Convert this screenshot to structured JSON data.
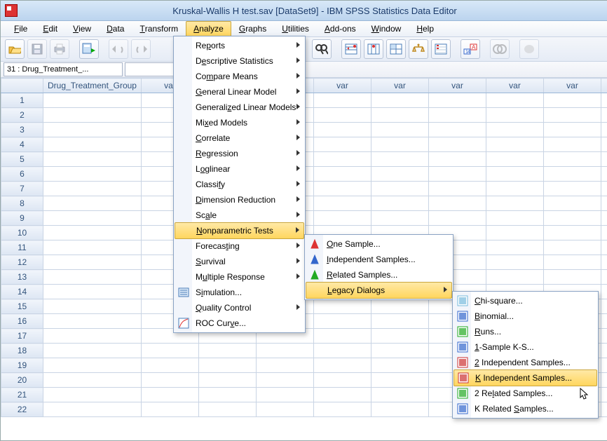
{
  "title": "Kruskal-Wallis H test.sav [DataSet9] - IBM SPSS Statistics Data Editor",
  "menubar": [
    "File",
    "Edit",
    "View",
    "Data",
    "Transform",
    "Analyze",
    "Graphs",
    "Utilities",
    "Add-ons",
    "Window",
    "Help"
  ],
  "menubar_active_index": 5,
  "cellref": "31 : Drug_Treatment_...",
  "columns": {
    "first": "Drug_Treatment_Group",
    "rest_label": "var"
  },
  "rows": 22,
  "analyze_menu": [
    {
      "label": "Reports",
      "sub": true
    },
    {
      "label": "Descriptive Statistics",
      "sub": true
    },
    {
      "label": "Compare Means",
      "sub": true
    },
    {
      "label": "General Linear Model",
      "sub": true
    },
    {
      "label": "Generalized Linear Models",
      "sub": true
    },
    {
      "label": "Mixed Models",
      "sub": true
    },
    {
      "label": "Correlate",
      "sub": true
    },
    {
      "label": "Regression",
      "sub": true
    },
    {
      "label": "Loglinear",
      "sub": true
    },
    {
      "label": "Classify",
      "sub": true
    },
    {
      "label": "Dimension Reduction",
      "sub": true
    },
    {
      "label": "Scale",
      "sub": true
    },
    {
      "label": "Nonparametric Tests",
      "sub": true,
      "hl": true
    },
    {
      "label": "Forecasting",
      "sub": true
    },
    {
      "label": "Survival",
      "sub": true
    },
    {
      "label": "Multiple Response",
      "sub": true
    },
    {
      "label": "Simulation...",
      "sub": false,
      "icon": "sim"
    },
    {
      "label": "Quality Control",
      "sub": true
    },
    {
      "label": "ROC Curve...",
      "sub": false,
      "icon": "roc"
    }
  ],
  "np_menu": [
    {
      "label": "One Sample...",
      "icon": "red"
    },
    {
      "label": "Independent Samples...",
      "icon": "blue"
    },
    {
      "label": "Related Samples...",
      "icon": "green"
    },
    {
      "label": "Legacy Dialogs",
      "sub": true,
      "hl": true
    }
  ],
  "legacy_menu": [
    {
      "label": "Chi-square...",
      "icon": "chi"
    },
    {
      "label": "Binomial...",
      "icon": "bin"
    },
    {
      "label": "Runs...",
      "icon": "runs"
    },
    {
      "label": "1-Sample K-S...",
      "icon": "ks"
    },
    {
      "label": "2 Independent Samples...",
      "icon": "ind2"
    },
    {
      "label": "K Independent Samples...",
      "icon": "indk",
      "hl": true
    },
    {
      "label": "2 Related Samples...",
      "icon": "rel2"
    },
    {
      "label": "K Related Samples...",
      "icon": "relk"
    }
  ],
  "toolbar_icons": [
    "open",
    "save",
    "print",
    "recall",
    "undo",
    "redo"
  ],
  "toolbar_icons_right": [
    "goto",
    "find",
    "insert-case",
    "insert-var",
    "split",
    "weight",
    "select",
    "value-labels",
    "use-sets",
    "spellcheck"
  ]
}
